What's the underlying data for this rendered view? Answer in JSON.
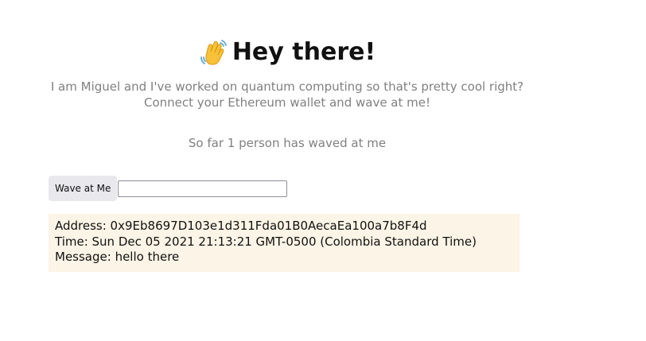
{
  "header": {
    "emoji_icon": "waving-hand-icon",
    "title": "Hey there!"
  },
  "bio": {
    "line1": "I am Miguel and I've worked on quantum computing so that's pretty cool right?",
    "line2": "Connect your Ethereum wallet and wave at me!"
  },
  "counter": {
    "text": "So far 1 person has waved at me"
  },
  "form": {
    "wave_button_label": "Wave at Me",
    "message_value": "",
    "message_placeholder": ""
  },
  "waves": [
    {
      "address": "Address: 0x9Eb8697D103e1d311Fda01B0AecaEa100a7b8F4d",
      "time": "Time: Sun Dec 05 2021 21:13:21 GMT-0500 (Colombia Standard Time)",
      "message": "Message: hello there"
    }
  ],
  "colors": {
    "card_background": "#fcf4e6",
    "muted_text": "#808080",
    "button_background": "#e9e9ed"
  }
}
